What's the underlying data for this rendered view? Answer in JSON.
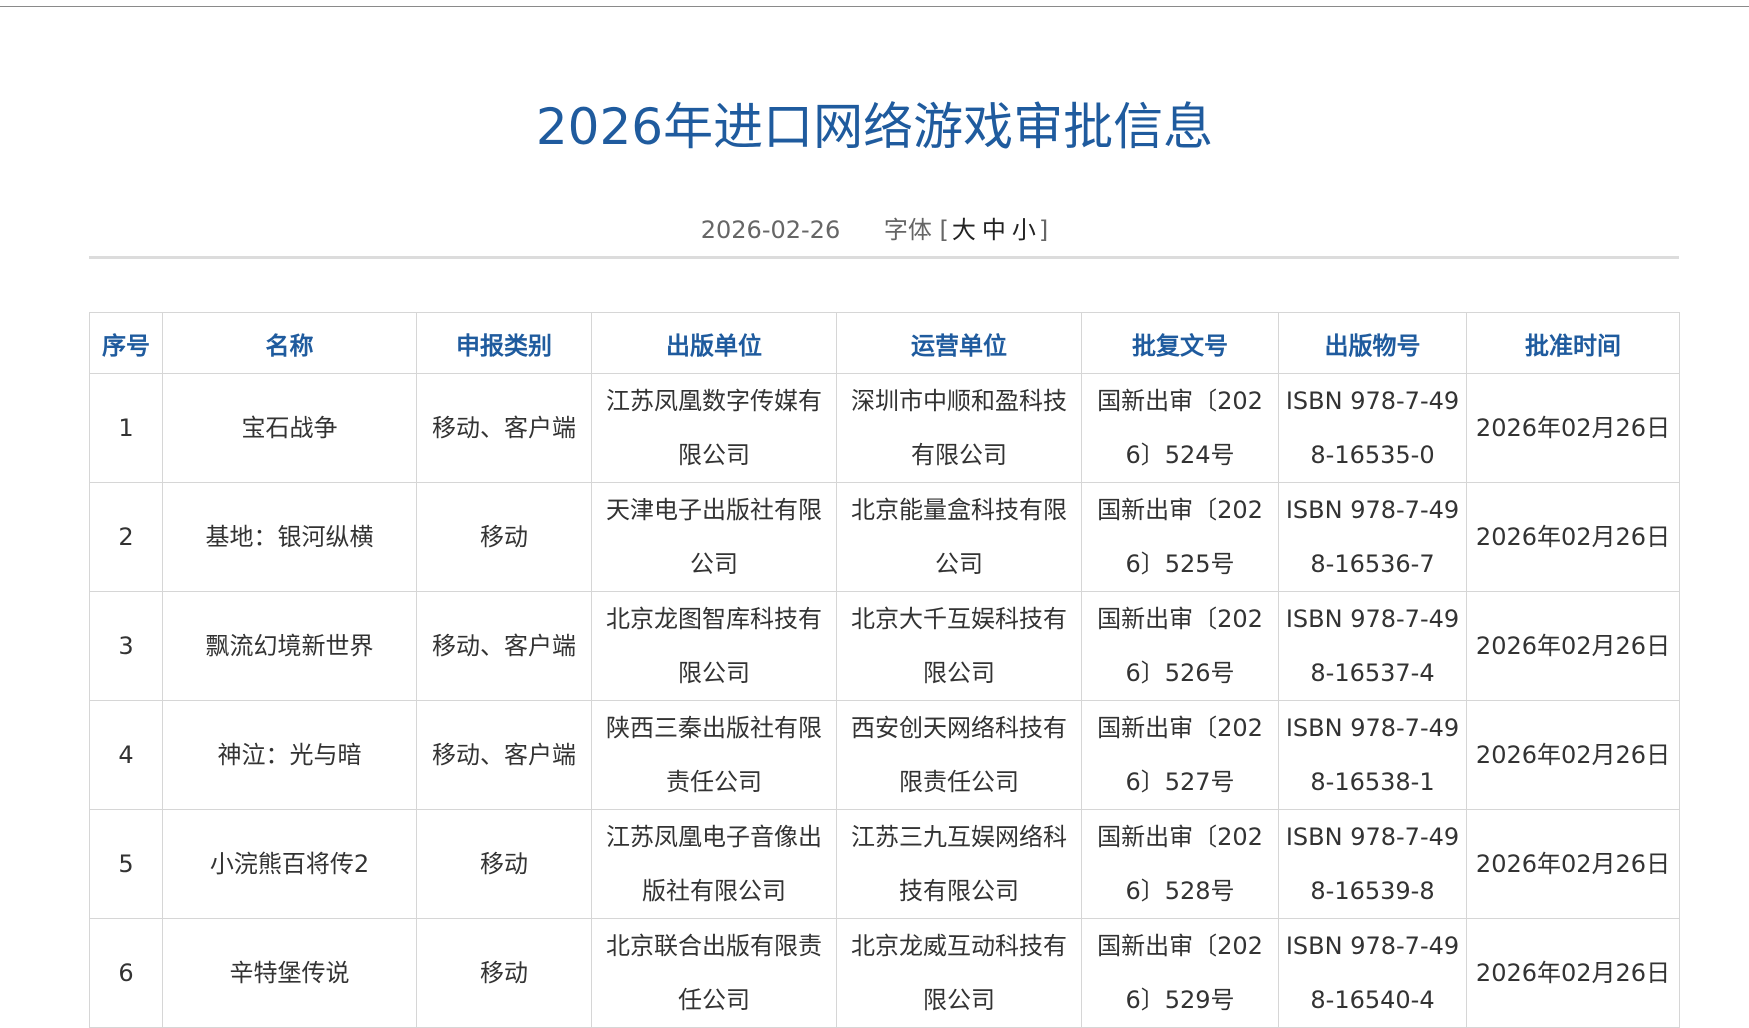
{
  "title": "2026年进口网络游戏审批信息",
  "meta": {
    "date": "2026-02-26",
    "font_label": "字体",
    "bracket_open": "[",
    "bracket_close": "]",
    "size_large": "大",
    "size_medium": "中",
    "size_small": "小"
  },
  "table": {
    "headers": [
      "序号",
      "名称",
      "申报类别",
      "出版单位",
      "运营单位",
      "批复文号",
      "出版物号",
      "批准时间"
    ],
    "rows": [
      [
        "1",
        "宝石战争",
        "移动、客户端",
        "江苏凤凰数字传媒有限公司",
        "深圳市中顺和盈科技有限公司",
        "国新出审〔2026〕524号",
        "ISBN 978-7-498-16535-0",
        "2026年02月26日"
      ],
      [
        "2",
        "基地：银河纵横",
        "移动",
        "天津电子出版社有限公司",
        "北京能量盒科技有限公司",
        "国新出审〔2026〕525号",
        "ISBN 978-7-498-16536-7",
        "2026年02月26日"
      ],
      [
        "3",
        "飘流幻境新世界",
        "移动、客户端",
        "北京龙图智库科技有限公司",
        "北京大千互娱科技有限公司",
        "国新出审〔2026〕526号",
        "ISBN 978-7-498-16537-4",
        "2026年02月26日"
      ],
      [
        "4",
        "神泣：光与暗",
        "移动、客户端",
        "陕西三秦出版社有限责任公司",
        "西安创天网络科技有限责任公司",
        "国新出审〔2026〕527号",
        "ISBN 978-7-498-16538-1",
        "2026年02月26日"
      ],
      [
        "5",
        "小浣熊百将传2",
        "移动",
        "江苏凤凰电子音像出版社有限公司",
        "江苏三九互娱网络科技有限公司",
        "国新出审〔2026〕528号",
        "ISBN 978-7-498-16539-8",
        "2026年02月26日"
      ],
      [
        "6",
        "辛特堡传说",
        "移动",
        "北京联合出版有限责任公司",
        "北京龙威互动科技有限公司",
        "国新出审〔2026〕529号",
        "ISBN 978-7-498-16540-4",
        "2026年02月26日"
      ]
    ]
  }
}
